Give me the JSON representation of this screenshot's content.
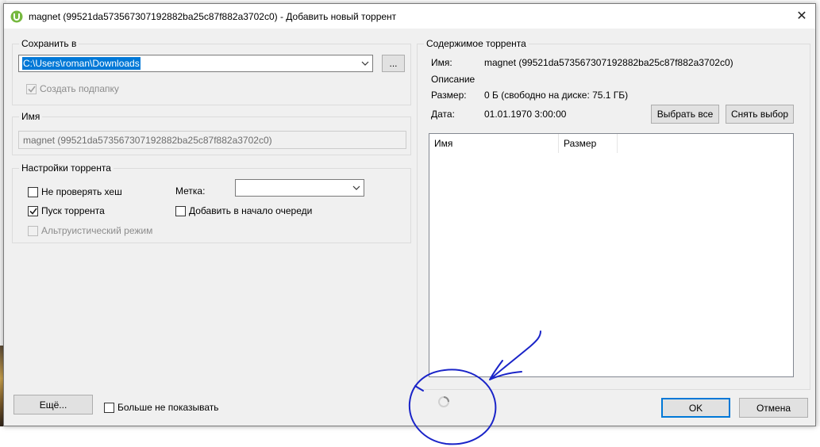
{
  "dialog": {
    "title": "magnet (99521da573567307192882ba25c87f882a3702c0) - Добавить новый торрент",
    "close_glyph": "✕"
  },
  "save": {
    "legend": "Сохранить в",
    "path": "C:\\Users\\roman\\Downloads",
    "browse_label": "...",
    "create_subfolder_label": "Создать подпапку"
  },
  "name": {
    "legend": "Имя",
    "value": "magnet (99521da573567307192882ba25c87f882a3702c0)"
  },
  "settings": {
    "legend": "Настройки торрента",
    "skip_hash_label": "Не проверять хеш",
    "start_label": "Пуск торрента",
    "superseed_label": "Альтруистический режим",
    "label_caption": "Метка:",
    "label_value": "",
    "add_to_top_label": "Добавить в начало очереди"
  },
  "contents": {
    "legend": "Содержимое торрента",
    "name_key": "Имя:",
    "name_value": "magnet (99521da573567307192882ba25c87f882a3702c0)",
    "description_key": "Описание",
    "size_key": "Размер:",
    "size_value": "0 Б (свободно на диске: 75.1 ГБ)",
    "date_key": "Дата:",
    "date_value": "01.01.1970 3:00:00",
    "select_all_label": "Выбрать все",
    "deselect_label": "Снять выбор",
    "columns": [
      "Имя",
      "Размер"
    ]
  },
  "footer": {
    "more_label": "Ещё...",
    "dont_show_label": "Больше не показывать",
    "ok_label": "OK",
    "cancel_label": "Отмена"
  },
  "colors": {
    "accent": "#0078d7",
    "annotation": "#1a24c8",
    "utorrent_green": "#76b83f"
  },
  "icons": [
    "utorrent-icon",
    "close-icon",
    "chevron-down-icon",
    "checkmark-icon",
    "loading-spinner-icon"
  ]
}
